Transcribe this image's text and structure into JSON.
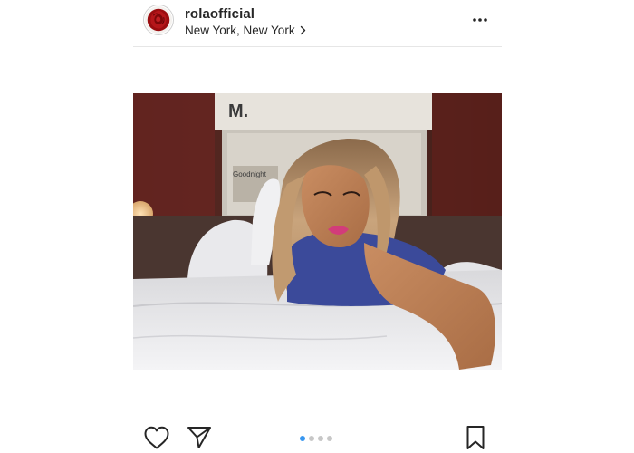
{
  "post": {
    "username": "rolaofficial",
    "location": "New York, New York",
    "avatar_icon": "rose-icon",
    "more_icon": "more-options-icon",
    "photo": {
      "sign_text": "M.",
      "caption_text": "Goodnight"
    },
    "actions": {
      "like_icon": "heart-icon",
      "share_icon": "paper-plane-icon",
      "save_icon": "bookmark-icon"
    },
    "carousel": {
      "total": 4,
      "active_index": 0,
      "active_color": "#3897f0",
      "inactive_color": "#c7c7c7"
    }
  }
}
